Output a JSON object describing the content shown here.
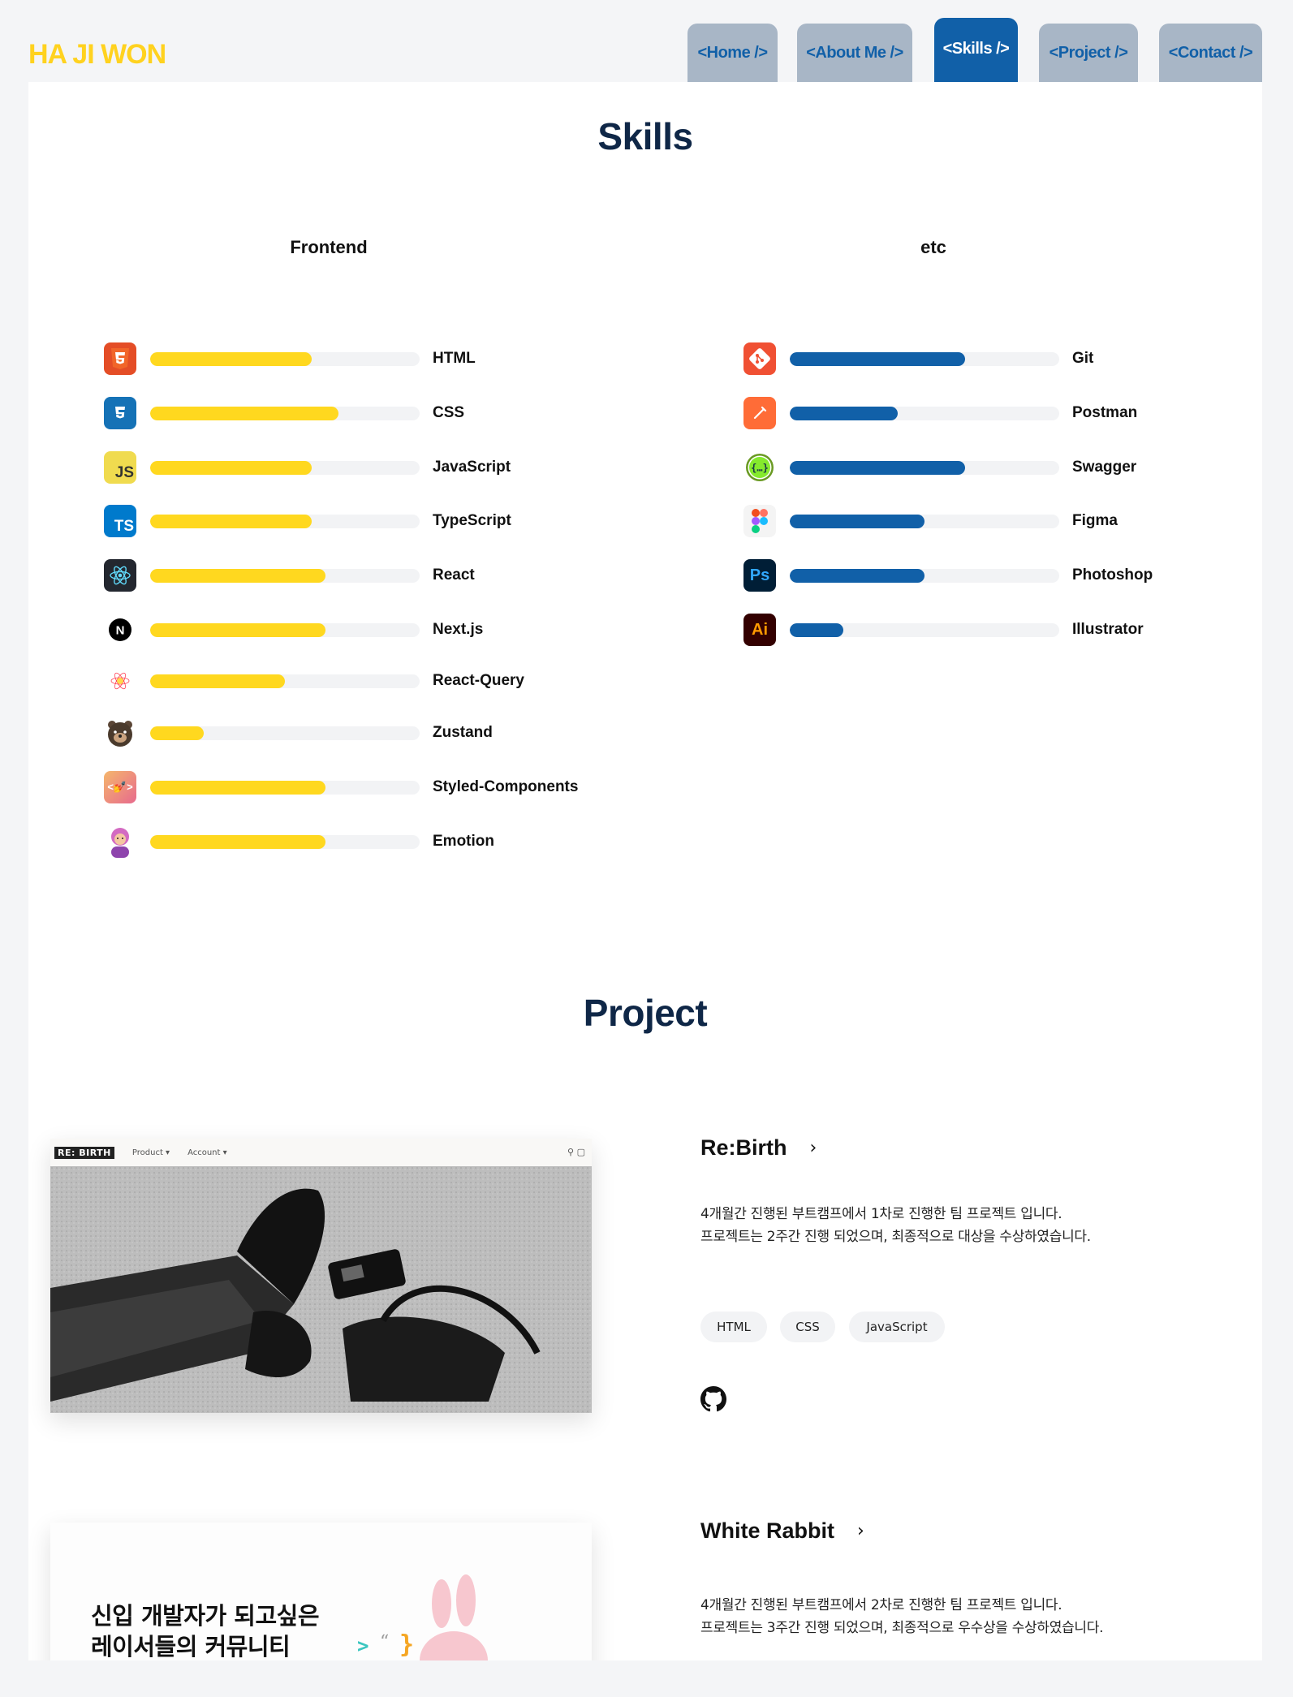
{
  "header": {
    "logo": "HA JI WON",
    "tabs": [
      {
        "label": "<Home />",
        "active": false
      },
      {
        "label": "<About Me />",
        "active": false
      },
      {
        "label": "<Skills />",
        "active": true
      },
      {
        "label": "<Project />",
        "active": false
      },
      {
        "label": "<Contact />",
        "active": false
      }
    ]
  },
  "skills": {
    "title": "Skills",
    "frontend": {
      "title": "Frontend",
      "bar_color": "#ffd81f",
      "items": [
        {
          "name": "HTML",
          "icon": "html5-icon",
          "level": 0.6
        },
        {
          "name": "CSS",
          "icon": "css3-icon",
          "level": 0.7
        },
        {
          "name": "JavaScript",
          "icon": "javascript-icon",
          "level": 0.6
        },
        {
          "name": "TypeScript",
          "icon": "typescript-icon",
          "level": 0.6
        },
        {
          "name": "React",
          "icon": "react-icon",
          "level": 0.65
        },
        {
          "name": "Next.js",
          "icon": "nextjs-icon",
          "level": 0.65
        },
        {
          "name": "React-Query",
          "icon": "react-query-icon",
          "level": 0.5
        },
        {
          "name": "Zustand",
          "icon": "zustand-bear-icon",
          "level": 0.2
        },
        {
          "name": "Styled-Components",
          "icon": "styled-components-icon",
          "level": 0.65
        },
        {
          "name": "Emotion",
          "icon": "emotion-icon",
          "level": 0.65
        }
      ]
    },
    "etc": {
      "title": "etc",
      "bar_color": "#1160a8",
      "items": [
        {
          "name": "Git",
          "icon": "git-icon",
          "level": 0.65
        },
        {
          "name": "Postman",
          "icon": "postman-icon",
          "level": 0.4
        },
        {
          "name": "Swagger",
          "icon": "swagger-icon",
          "level": 0.65
        },
        {
          "name": "Figma",
          "icon": "figma-icon",
          "level": 0.5
        },
        {
          "name": "Photoshop",
          "icon": "photoshop-icon",
          "level": 0.5
        },
        {
          "name": "Illustrator",
          "icon": "illustrator-icon",
          "level": 0.2
        }
      ]
    }
  },
  "project": {
    "title": "Project",
    "items": [
      {
        "title": "Re:Birth",
        "arrow": "›",
        "desc_line1": "4개월간 진행된 부트캠프에서 1차로 진행한 팀 프로젝트 입니다.",
        "desc_line2": "프로젝트는 2주간 진행 되었으며, 최종적으로 대상을 수상하였습니다.",
        "tags": [
          "HTML",
          "CSS",
          "JavaScript"
        ],
        "preview": {
          "brand": "RE: BIRTH",
          "menu1": "Product ▾",
          "menu2": "Account ▾"
        }
      },
      {
        "title": "White Rabbit",
        "arrow": "›",
        "desc_line1": "4개월간 진행된 부트캠프에서 2차로 진행한 팀 프로젝트 입니다.",
        "desc_line2": "프로젝트는 3주간 진행 되었으며, 최종적으로 우수상을 수상하였습니다.",
        "preview": {
          "line1": "신입 개발자가 되고싶은",
          "line2": "레이서들의 커뮤니티"
        }
      }
    ]
  }
}
